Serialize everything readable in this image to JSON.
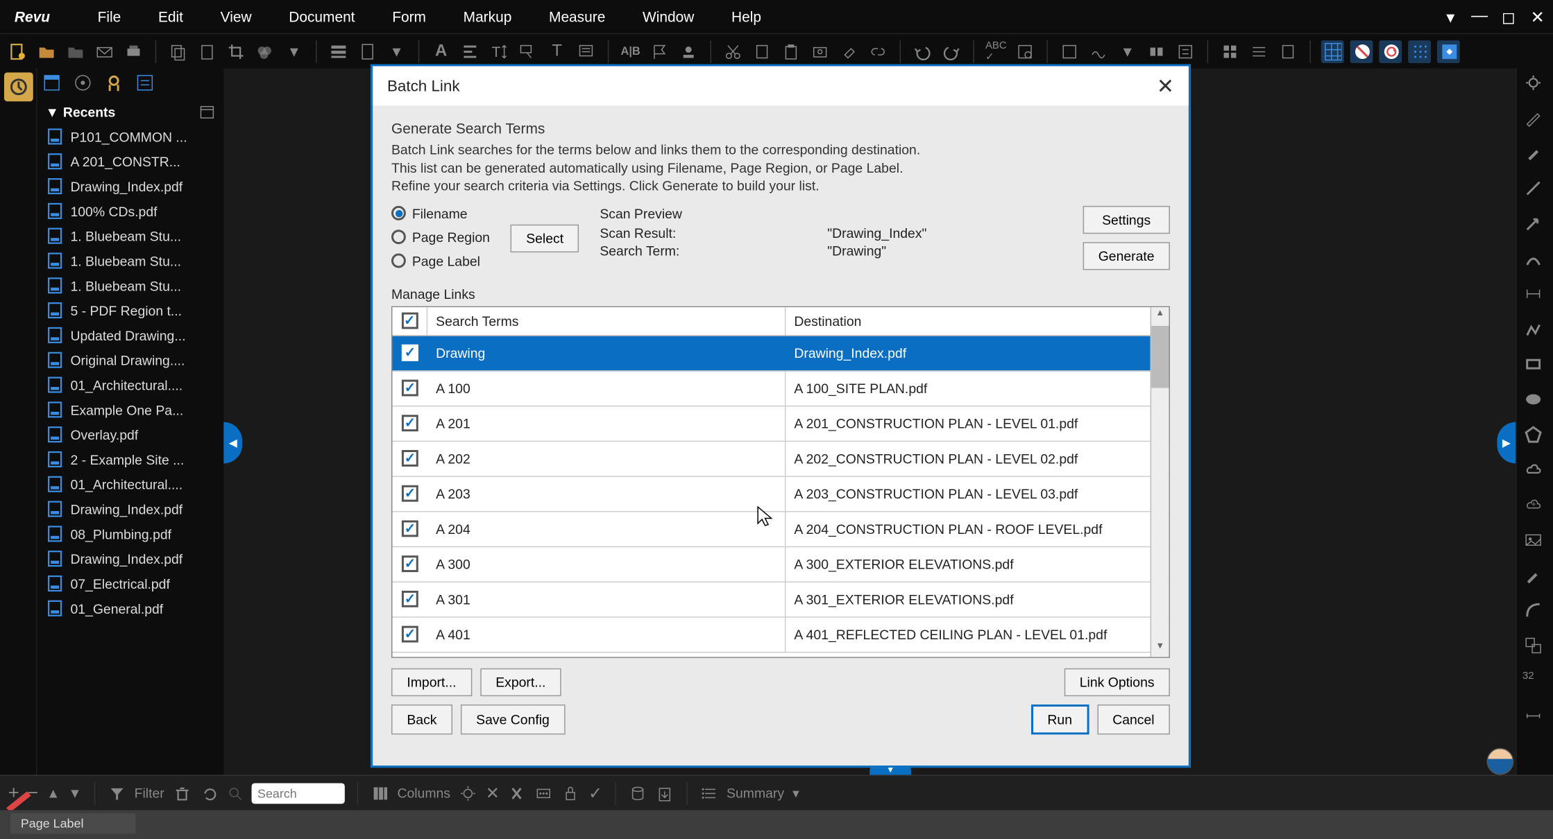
{
  "app": {
    "logo": "Revu"
  },
  "menu": [
    "File",
    "Edit",
    "View",
    "Document",
    "Form",
    "Markup",
    "Measure",
    "Window",
    "Help"
  ],
  "sidebar": {
    "recents_label": "Recents",
    "items": [
      "P101_COMMON ...",
      "A 201_CONSTR...",
      "Drawing_Index.pdf",
      "100% CDs.pdf",
      "1. Bluebeam Stu...",
      "1. Bluebeam Stu...",
      "1. Bluebeam Stu...",
      "5 - PDF Region t...",
      "Updated Drawing...",
      "Original Drawing....",
      "01_Architectural....",
      "Example One Pa...",
      "Overlay.pdf",
      "2 - Example Site ...",
      "01_Architectural....",
      "Drawing_Index.pdf",
      "08_Plumbing.pdf",
      "Drawing_Index.pdf",
      "07_Electrical.pdf",
      "01_General.pdf"
    ]
  },
  "dialog": {
    "title": "Batch Link",
    "section": "Generate Search Terms",
    "desc1": "Batch Link searches for the terms below and links them to the corresponding destination.",
    "desc2": "This list can be generated automatically using Filename, Page Region, or Page Label.",
    "desc3": "Refine your search criteria via Settings. Click Generate to build your list.",
    "radios": {
      "filename": "Filename",
      "page_region": "Page Region",
      "page_label": "Page Label"
    },
    "select_btn": "Select",
    "scan": {
      "title": "Scan Preview",
      "result_label": "Scan Result:",
      "result_value": "\"Drawing_Index\"",
      "term_label": "Search Term:",
      "term_value": "\"Drawing\""
    },
    "settings_btn": "Settings",
    "generate_btn": "Generate",
    "manage_label": "Manage Links",
    "columns": {
      "terms": "Search Terms",
      "dest": "Destination"
    },
    "rows": [
      {
        "term": "Drawing",
        "dest": "Drawing_Index.pdf",
        "selected": true
      },
      {
        "term": "A 100",
        "dest": "A 100_SITE PLAN.pdf"
      },
      {
        "term": "A 201",
        "dest": "A 201_CONSTRUCTION PLAN - LEVEL 01.pdf"
      },
      {
        "term": "A 202",
        "dest": "A 202_CONSTRUCTION PLAN - LEVEL 02.pdf"
      },
      {
        "term": "A 203",
        "dest": "A 203_CONSTRUCTION PLAN - LEVEL 03.pdf"
      },
      {
        "term": "A 204",
        "dest": "A 204_CONSTRUCTION PLAN - ROOF LEVEL.pdf"
      },
      {
        "term": "A 300",
        "dest": "A 300_EXTERIOR ELEVATIONS.pdf"
      },
      {
        "term": "A 301",
        "dest": "A 301_EXTERIOR ELEVATIONS.pdf"
      },
      {
        "term": "A 401",
        "dest": "A 401_REFLECTED CEILING PLAN - LEVEL 01.pdf"
      }
    ],
    "import_btn": "Import...",
    "export_btn": "Export...",
    "link_options_btn": "Link Options",
    "back_btn": "Back",
    "save_config_btn": "Save Config",
    "run_btn": "Run",
    "cancel_btn": "Cancel"
  },
  "bottombar": {
    "filter": "Filter",
    "search_placeholder": "Search",
    "columns": "Columns",
    "summary": "Summary"
  },
  "status": {
    "page_label": "Page Label"
  }
}
